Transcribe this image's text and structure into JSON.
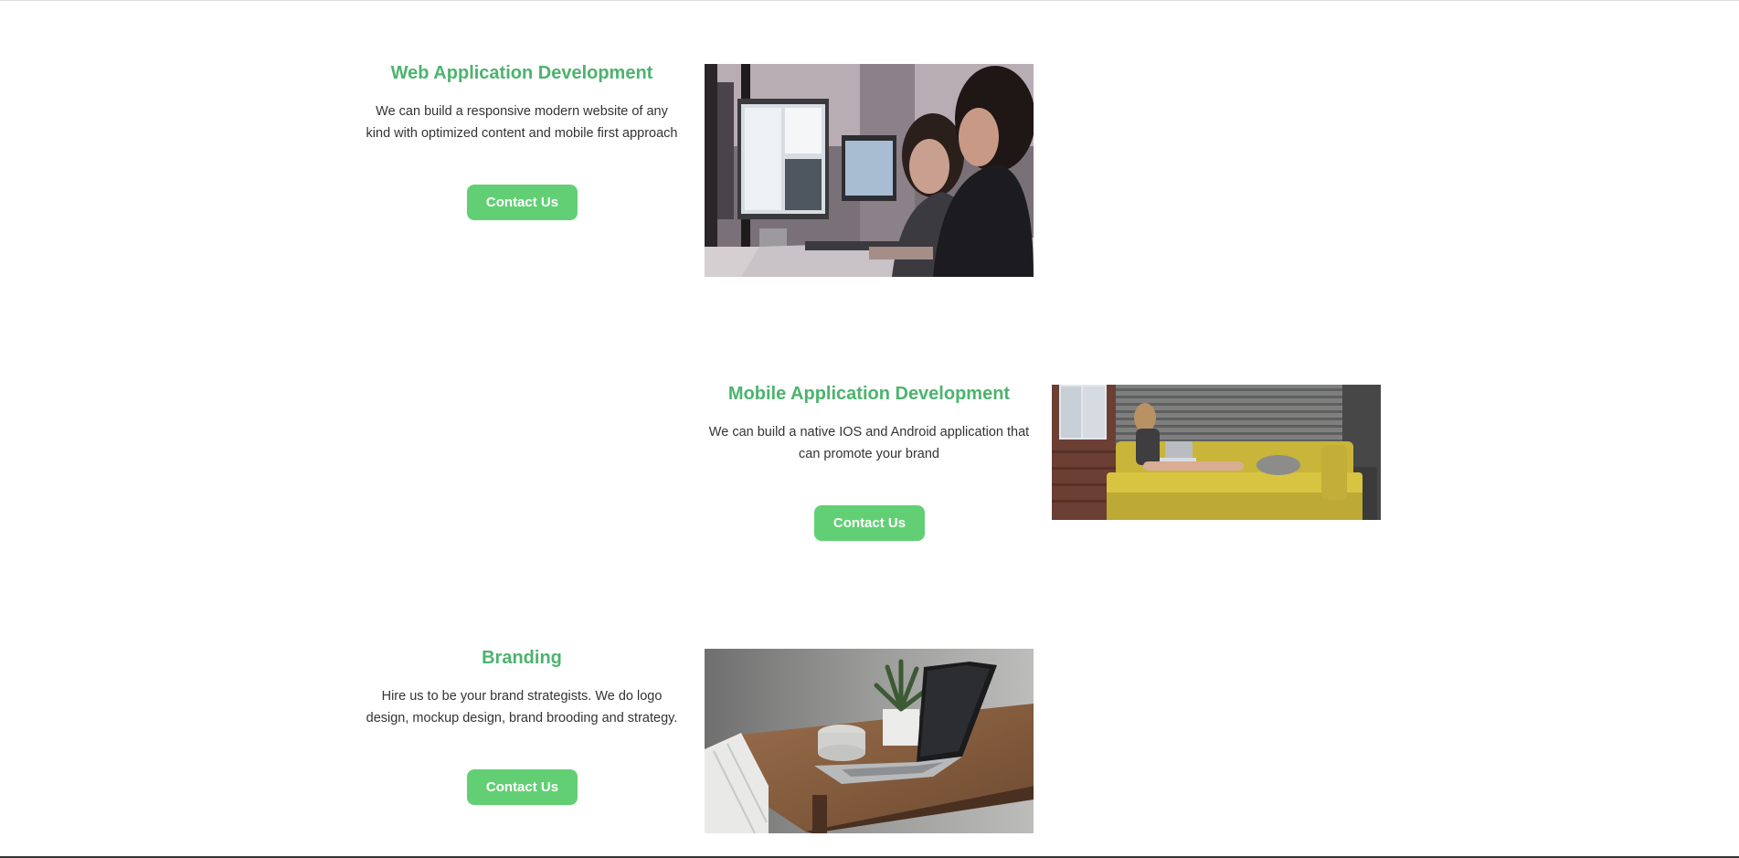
{
  "services": [
    {
      "title": "Web Application Development",
      "description_line1": "We can build a responsive modern website of any",
      "description_line2": "kind with optimized content and mobile first approach",
      "button_label": "Contact Us",
      "photo_alt": "People working at computer monitors in an office"
    },
    {
      "title": "Mobile Application Development",
      "description_line1": "We can build a native IOS and Android application that",
      "description_line2": "can promote your brand",
      "button_label": "Contact Us",
      "photo_alt": "Woman using a laptop on a yellow sofa"
    },
    {
      "title": "Branding",
      "description_line1": "Hire us to be your brand strategists. We do logo",
      "description_line2": "design, mockup design, brand brooding and strategy.",
      "button_label": "Contact Us",
      "photo_alt": "Laptop, cup and potted plant on a wooden desk"
    }
  ],
  "colors": {
    "heading": "#4cb36e",
    "button": "#62cf74",
    "body_text": "#333333"
  }
}
